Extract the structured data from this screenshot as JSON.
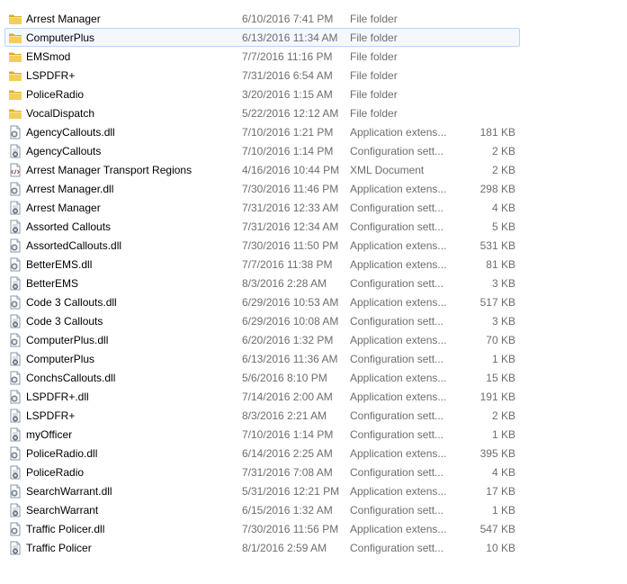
{
  "files": [
    {
      "name": "Arrest Manager",
      "date": "6/10/2016 7:41 PM",
      "type": "File folder",
      "size": "",
      "icon": "folder-icon"
    },
    {
      "name": "ComputerPlus",
      "date": "6/13/2016 11:34 AM",
      "type": "File folder",
      "size": "",
      "icon": "folder-icon",
      "hovered": true
    },
    {
      "name": "EMSmod",
      "date": "7/7/2016 11:16 PM",
      "type": "File folder",
      "size": "",
      "icon": "folder-icon"
    },
    {
      "name": "LSPDFR+",
      "date": "7/31/2016 6:54 AM",
      "type": "File folder",
      "size": "",
      "icon": "folder-icon"
    },
    {
      "name": "PoliceRadio",
      "date": "3/20/2016 1:15 AM",
      "type": "File folder",
      "size": "",
      "icon": "folder-icon"
    },
    {
      "name": "VocalDispatch",
      "date": "5/22/2016 12:12 AM",
      "type": "File folder",
      "size": "",
      "icon": "folder-icon"
    },
    {
      "name": "AgencyCallouts.dll",
      "date": "7/10/2016 1:21 PM",
      "type": "Application extens...",
      "size": "181 KB",
      "icon": "dll-file-icon"
    },
    {
      "name": "AgencyCallouts",
      "date": "7/10/2016 1:14 PM",
      "type": "Configuration sett...",
      "size": "2 KB",
      "icon": "config-file-icon"
    },
    {
      "name": "Arrest Manager Transport Regions",
      "date": "4/16/2016 10:44 PM",
      "type": "XML Document",
      "size": "2 KB",
      "icon": "xml-file-icon"
    },
    {
      "name": "Arrest Manager.dll",
      "date": "7/30/2016 11:46 PM",
      "type": "Application extens...",
      "size": "298 KB",
      "icon": "dll-file-icon"
    },
    {
      "name": "Arrest Manager",
      "date": "7/31/2016 12:33 AM",
      "type": "Configuration sett...",
      "size": "4 KB",
      "icon": "config-file-icon"
    },
    {
      "name": "Assorted Callouts",
      "date": "7/31/2016 12:34 AM",
      "type": "Configuration sett...",
      "size": "5 KB",
      "icon": "config-file-icon"
    },
    {
      "name": "AssortedCallouts.dll",
      "date": "7/30/2016 11:50 PM",
      "type": "Application extens...",
      "size": "531 KB",
      "icon": "dll-file-icon"
    },
    {
      "name": "BetterEMS.dll",
      "date": "7/7/2016 11:38 PM",
      "type": "Application extens...",
      "size": "81 KB",
      "icon": "dll-file-icon"
    },
    {
      "name": "BetterEMS",
      "date": "8/3/2016 2:28 AM",
      "type": "Configuration sett...",
      "size": "3 KB",
      "icon": "config-file-icon"
    },
    {
      "name": "Code 3 Callouts.dll",
      "date": "6/29/2016 10:53 AM",
      "type": "Application extens...",
      "size": "517 KB",
      "icon": "dll-file-icon"
    },
    {
      "name": "Code 3 Callouts",
      "date": "6/29/2016 10:08 AM",
      "type": "Configuration sett...",
      "size": "3 KB",
      "icon": "config-file-icon"
    },
    {
      "name": "ComputerPlus.dll",
      "date": "6/20/2016 1:32 PM",
      "type": "Application extens...",
      "size": "70 KB",
      "icon": "dll-file-icon"
    },
    {
      "name": "ComputerPlus",
      "date": "6/13/2016 11:36 AM",
      "type": "Configuration sett...",
      "size": "1 KB",
      "icon": "config-file-icon"
    },
    {
      "name": "ConchsCallouts.dll",
      "date": "5/6/2016 8:10 PM",
      "type": "Application extens...",
      "size": "15 KB",
      "icon": "dll-file-icon"
    },
    {
      "name": "LSPDFR+.dll",
      "date": "7/14/2016 2:00 AM",
      "type": "Application extens...",
      "size": "191 KB",
      "icon": "dll-file-icon"
    },
    {
      "name": "LSPDFR+",
      "date": "8/3/2016 2:21 AM",
      "type": "Configuration sett...",
      "size": "2 KB",
      "icon": "config-file-icon"
    },
    {
      "name": "myOfficer",
      "date": "7/10/2016 1:14 PM",
      "type": "Configuration sett...",
      "size": "1 KB",
      "icon": "config-file-icon"
    },
    {
      "name": "PoliceRadio.dll",
      "date": "6/14/2016 2:25 AM",
      "type": "Application extens...",
      "size": "395 KB",
      "icon": "dll-file-icon"
    },
    {
      "name": "PoliceRadio",
      "date": "7/31/2016 7:08 AM",
      "type": "Configuration sett...",
      "size": "4 KB",
      "icon": "config-file-icon"
    },
    {
      "name": "SearchWarrant.dll",
      "date": "5/31/2016 12:21 PM",
      "type": "Application extens...",
      "size": "17 KB",
      "icon": "dll-file-icon"
    },
    {
      "name": "SearchWarrant",
      "date": "6/15/2016 1:32 AM",
      "type": "Configuration sett...",
      "size": "1 KB",
      "icon": "config-file-icon"
    },
    {
      "name": "Traffic Policer.dll",
      "date": "7/30/2016 11:56 PM",
      "type": "Application extens...",
      "size": "547 KB",
      "icon": "dll-file-icon"
    },
    {
      "name": "Traffic Policer",
      "date": "8/1/2016 2:59 AM",
      "type": "Configuration sett...",
      "size": "10 KB",
      "icon": "config-file-icon"
    }
  ],
  "colors": {
    "folder": "#e8c24a",
    "hover_bg": "#f4f8fd",
    "hover_border": "#b8d6fb",
    "muted_text": "#6d6d6d"
  }
}
